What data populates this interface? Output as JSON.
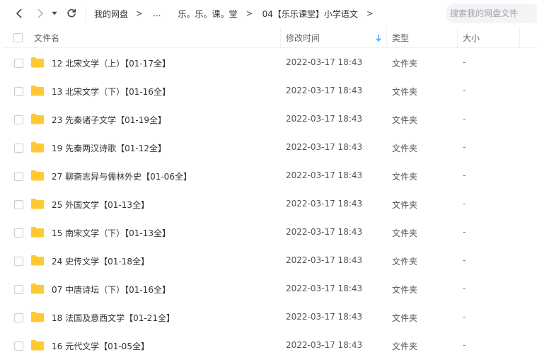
{
  "toolbar": {
    "breadcrumb": [
      "我的网盘",
      "...",
      "乐。乐。课。堂",
      "04【乐乐课堂】小学语文"
    ],
    "breadcrumb_sep": ">",
    "search_placeholder": "搜索我的网盘文件"
  },
  "header": {
    "name": "文件名",
    "modified": "修改时间",
    "type": "类型",
    "size": "大小"
  },
  "colors": {
    "folder": "#ffc933",
    "sort_arrow": "#3b8cff"
  },
  "files": [
    {
      "name": "12 北宋文学（上）【01-17全】",
      "modified": "2022-03-17 18:43",
      "type": "文件夹",
      "size": "-"
    },
    {
      "name": "13 北宋文学（下）【01-16全】",
      "modified": "2022-03-17 18:43",
      "type": "文件夹",
      "size": "-"
    },
    {
      "name": "23 先秦诸子文学【01-19全】",
      "modified": "2022-03-17 18:43",
      "type": "文件夹",
      "size": "-"
    },
    {
      "name": "19 先秦两汉诗歌【01-12全】",
      "modified": "2022-03-17 18:43",
      "type": "文件夹",
      "size": "-"
    },
    {
      "name": "27 聊斋志异与儒林外史【01-06全】",
      "modified": "2022-03-17 18:43",
      "type": "文件夹",
      "size": "-"
    },
    {
      "name": "25 外国文学【01-13全】",
      "modified": "2022-03-17 18:43",
      "type": "文件夹",
      "size": "-"
    },
    {
      "name": "15 南宋文学（下）【01-13全】",
      "modified": "2022-03-17 18:43",
      "type": "文件夹",
      "size": "-"
    },
    {
      "name": "24 史传文学【01-18全】",
      "modified": "2022-03-17 18:43",
      "type": "文件夹",
      "size": "-"
    },
    {
      "name": "07 中唐诗坛（下）【01-16全】",
      "modified": "2022-03-17 18:43",
      "type": "文件夹",
      "size": "-"
    },
    {
      "name": "18 法国及意西文学【01-21全】",
      "modified": "2022-03-17 18:43",
      "type": "文件夹",
      "size": "-"
    },
    {
      "name": "16 元代文学【01-05全】",
      "modified": "2022-03-17 18:43",
      "type": "文件夹",
      "size": "-"
    }
  ]
}
